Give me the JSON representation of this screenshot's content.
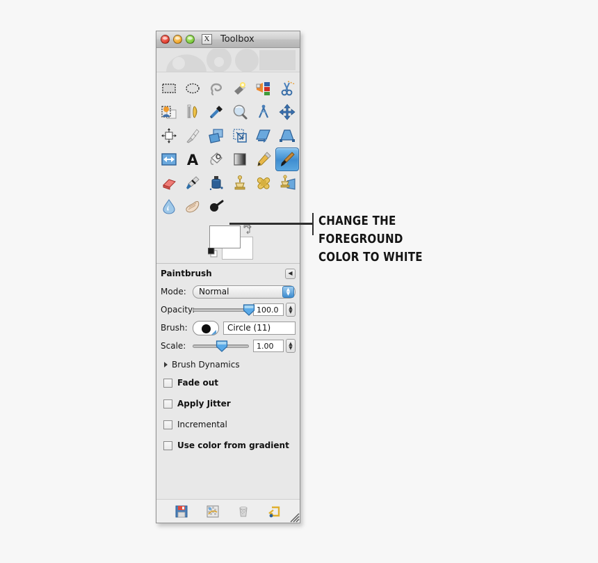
{
  "window": {
    "title": "Toolbox",
    "app_icon_glyph": "X",
    "controls": [
      {
        "name": "close",
        "color": "#e03c2c"
      },
      {
        "name": "minimize",
        "color": "#f0a62a"
      },
      {
        "name": "maximize",
        "color": "#79c93a"
      }
    ]
  },
  "toolbox": {
    "tools": [
      {
        "name": "rect-select-tool",
        "label": "Rectangle Select"
      },
      {
        "name": "ellipse-select-tool",
        "label": "Ellipse Select"
      },
      {
        "name": "free-select-tool",
        "label": "Free Select"
      },
      {
        "name": "fuzzy-select-tool",
        "label": "Fuzzy Select"
      },
      {
        "name": "select-by-color-tool",
        "label": "Select by Color"
      },
      {
        "name": "scissors-select-tool",
        "label": "Scissors Select"
      },
      {
        "name": "foreground-select-tool",
        "label": "Foreground Select"
      },
      {
        "name": "paths-tool",
        "label": "Paths"
      },
      {
        "name": "color-picker-tool",
        "label": "Color Picker"
      },
      {
        "name": "zoom-tool",
        "label": "Zoom"
      },
      {
        "name": "measure-tool",
        "label": "Measure"
      },
      {
        "name": "move-tool",
        "label": "Move"
      },
      {
        "name": "alignment-tool",
        "label": "Alignment"
      },
      {
        "name": "crop-tool",
        "label": "Crop"
      },
      {
        "name": "rotate-tool",
        "label": "Rotate"
      },
      {
        "name": "scale-tool",
        "label": "Scale"
      },
      {
        "name": "shear-tool",
        "label": "Shear"
      },
      {
        "name": "perspective-tool",
        "label": "Perspective"
      },
      {
        "name": "flip-tool",
        "label": "Flip"
      },
      {
        "name": "text-tool",
        "label": "Text"
      },
      {
        "name": "bucket-fill-tool",
        "label": "Bucket Fill"
      },
      {
        "name": "gradient-tool",
        "label": "Blend"
      },
      {
        "name": "pencil-tool",
        "label": "Pencil"
      },
      {
        "name": "paintbrush-tool",
        "label": "Paintbrush",
        "selected": true
      },
      {
        "name": "eraser-tool",
        "label": "Eraser"
      },
      {
        "name": "airbrush-tool",
        "label": "Airbrush"
      },
      {
        "name": "ink-tool",
        "label": "Ink"
      },
      {
        "name": "clone-tool",
        "label": "Clone"
      },
      {
        "name": "heal-tool",
        "label": "Heal"
      },
      {
        "name": "perspective-clone-tool",
        "label": "Perspective Clone"
      },
      {
        "name": "blur-sharpen-tool",
        "label": "Blur / Sharpen"
      },
      {
        "name": "smudge-tool",
        "label": "Smudge"
      },
      {
        "name": "dodge-burn-tool",
        "label": "Dodge / Burn"
      }
    ],
    "colors": {
      "foreground": "#ffffff",
      "background": "#ffffff",
      "default_fg": "#000000",
      "default_bg": "#ffffff"
    }
  },
  "tool_options": {
    "title": "Paintbrush",
    "collapse_glyph": "◀",
    "mode": {
      "label": "Mode:",
      "value": "Normal"
    },
    "opacity": {
      "label": "Opacity:",
      "value": "100.0",
      "fraction": 1.0
    },
    "brush": {
      "label": "Brush:",
      "value": "Circle (11)"
    },
    "scale": {
      "label": "Scale:",
      "value": "1.00",
      "fraction": 0.5
    },
    "brush_dynamics": {
      "label": "Brush Dynamics",
      "expanded": false
    },
    "checkboxes": [
      {
        "name": "fade-out",
        "label": "Fade out",
        "checked": false,
        "bold": true
      },
      {
        "name": "apply-jitter",
        "label": "Apply Jitter",
        "checked": false,
        "bold": true
      },
      {
        "name": "incremental",
        "label": "Incremental",
        "checked": false,
        "bold": false
      },
      {
        "name": "use-color-from-gradient",
        "label": "Use color from gradient",
        "checked": false,
        "bold": true
      }
    ]
  },
  "bottom_bar": {
    "buttons": [
      {
        "name": "save-options-button",
        "label": "Save tool options"
      },
      {
        "name": "restore-options-button",
        "label": "Restore tool options"
      },
      {
        "name": "delete-options-button",
        "label": "Delete tool options"
      },
      {
        "name": "reset-options-button",
        "label": "Reset tool options"
      }
    ]
  },
  "annotation": {
    "text": "CHANGE THE  FOREGROUND\nCOLOR TO WHITE",
    "color": "#141414"
  }
}
